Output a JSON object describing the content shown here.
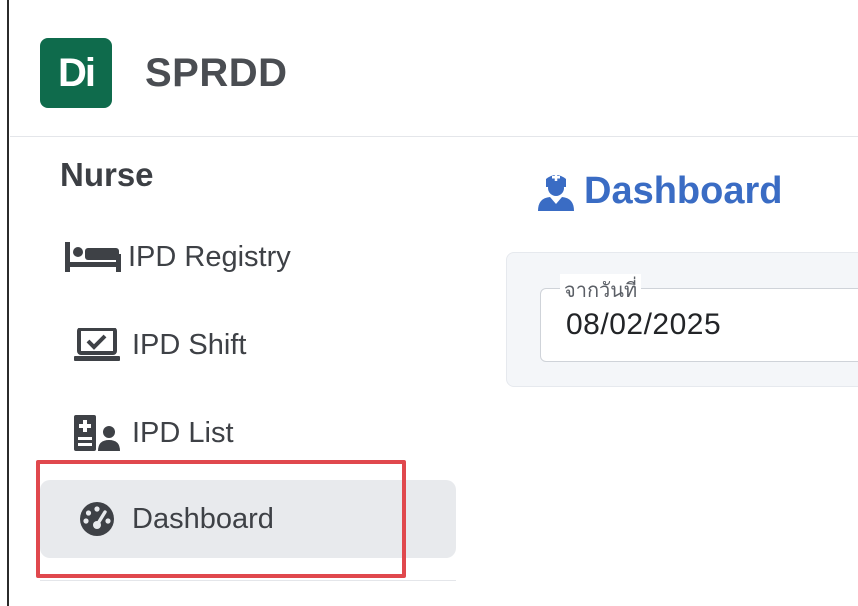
{
  "app": {
    "logo_text": "Di",
    "name": "SPRDD",
    "brand_color": "#0f6b4c"
  },
  "sidebar": {
    "section_title": "Nurse",
    "items": [
      {
        "label": "IPD Registry",
        "icon": "bed-icon",
        "active": false
      },
      {
        "label": "IPD Shift",
        "icon": "laptop-check-icon",
        "active": false
      },
      {
        "label": "IPD List",
        "icon": "patient-list-icon",
        "active": false
      },
      {
        "label": "Dashboard",
        "icon": "gauge-icon",
        "active": true
      }
    ],
    "highlight_color": "#e0484d"
  },
  "main": {
    "heading": "Dashboard",
    "heading_icon": "user-nurse-icon",
    "heading_color": "#3a6cc4",
    "filter": {
      "from_date_label": "จากวันที่",
      "from_date_value": "08/02/2025"
    }
  }
}
